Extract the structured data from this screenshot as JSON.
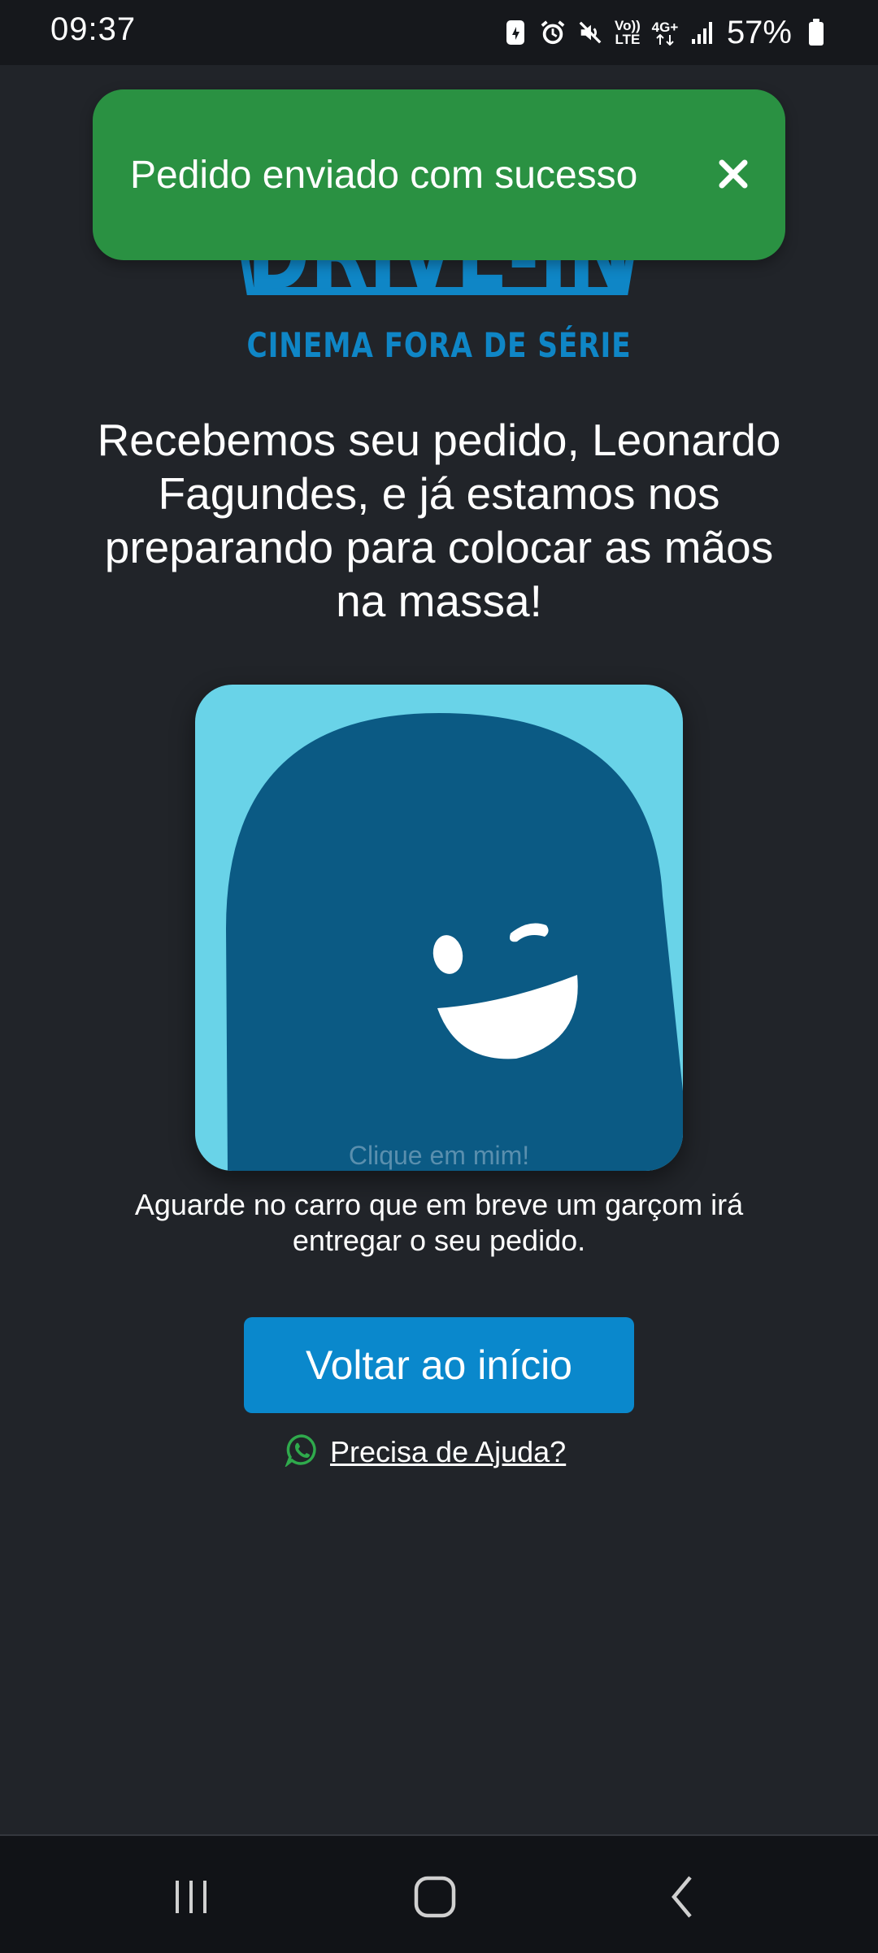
{
  "status_bar": {
    "time": "09:37",
    "network_tech_top": "4G+",
    "volte_label_top": "Vo))",
    "volte_label_bottom": "LTE",
    "battery_percent": "57%",
    "icons": [
      "data-saver-icon",
      "alarm-icon",
      "mute-icon",
      "volte-icon",
      "network-4g-icon",
      "signal-icon",
      "battery-icon"
    ]
  },
  "logo": {
    "main_text": "DRIVE-IN",
    "subtitle": "CINEMA FORA DE SÉRIE",
    "color": "#0f86c6"
  },
  "toast": {
    "message": "Pedido enviado com sucesso",
    "close_icon": "close-icon",
    "color": "#2a9142"
  },
  "headline": "Recebemos seu pedido, Leonardo Fagundes, e já estamos nos preparando para colocar as mãos na massa!",
  "mascot": {
    "hint": "Clique em mim!",
    "background": "#69d3e8",
    "body_color": "#0b5a84"
  },
  "wait_message": "Aguarde no carro que em breve um garçom irá entregar o seu pedido.",
  "back_button_label": "Voltar ao início",
  "help_link": {
    "label": "Precisa de Ajuda?",
    "icon": "whatsapp-icon"
  },
  "nav": {
    "icons": [
      "recent-apps-icon",
      "home-icon",
      "back-icon"
    ]
  }
}
